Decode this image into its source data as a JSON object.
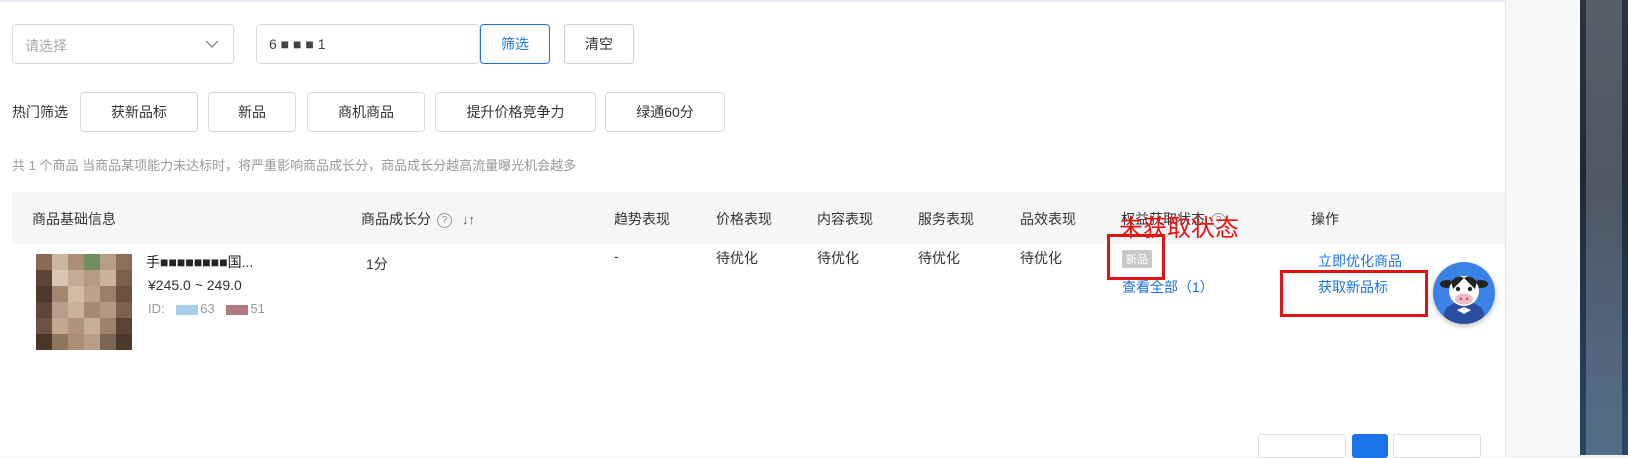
{
  "filters": {
    "select_placeholder": "请选择",
    "search_value": "6 ■ ■ ■ 1",
    "filter_button": "筛选",
    "clear_button": "清空"
  },
  "hot_filters": {
    "label": "热门筛选",
    "tags": [
      "获新品标",
      "新品",
      "商机商品",
      "提升价格竞争力",
      "绿通60分"
    ]
  },
  "summary": "共 1 个商品 当商品某项能力未达标时，将严重影响商品成长分，商品成长分越高流量曝光机会越多",
  "table": {
    "headers": {
      "product_info": "商品基础信息",
      "growth_score": "商品成长分",
      "trend": "趋势表现",
      "price": "价格表现",
      "content": "内容表现",
      "service": "服务表现",
      "quality": "品效表现",
      "rights": "权益获取状态",
      "actions": "操作"
    },
    "rows": [
      {
        "name": "手■■■■■■■■国...",
        "price_range": "¥245.0 ~ 249.0",
        "id_label": "ID:",
        "id_fragments": [
          "63",
          "51"
        ],
        "growth_score": "1分",
        "trend": "-",
        "price": "待优化",
        "content": "待优化",
        "service": "待优化",
        "quality": "待优化",
        "rights_badge": "新品",
        "rights_view_all": "查看全部（1）",
        "action_optimize": "立即优化商品",
        "action_get_tag": "获取新品标"
      }
    ]
  },
  "annotation": {
    "text": "未获取状态",
    "color": "#ee1111"
  },
  "colors": {
    "accent": "#1a73e8",
    "annotation_red": "#e31313"
  }
}
